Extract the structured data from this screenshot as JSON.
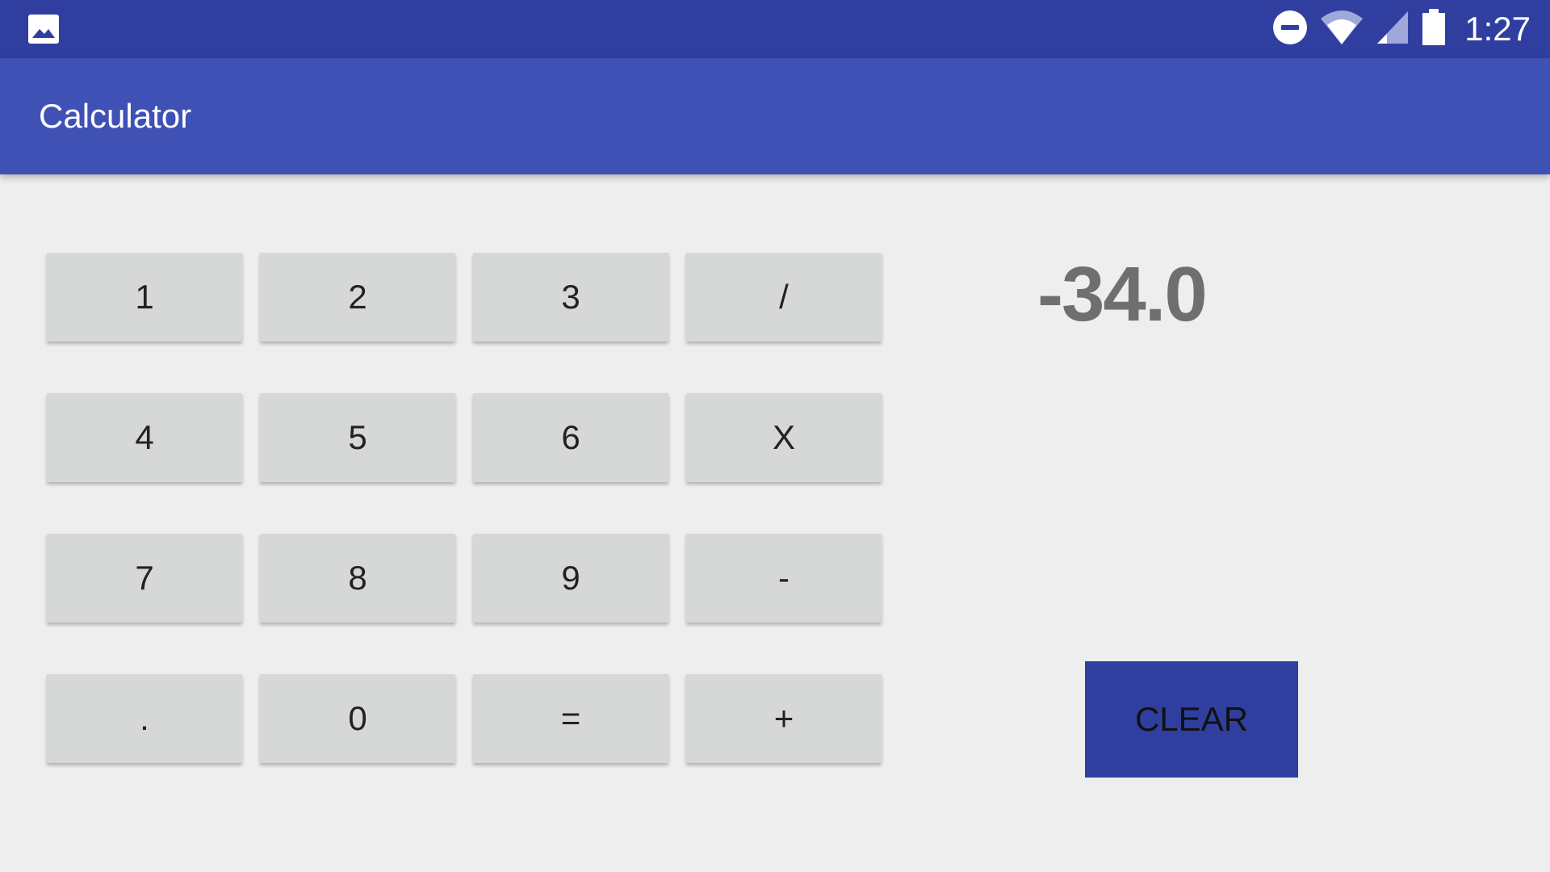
{
  "status_bar": {
    "time": "1:27",
    "icons": [
      "image-icon",
      "do-not-disturb-icon",
      "wifi-icon",
      "signal-icon",
      "battery-icon"
    ]
  },
  "app_bar": {
    "title": "Calculator"
  },
  "display": {
    "value": "-34.0"
  },
  "keypad": {
    "keys": [
      "1",
      "2",
      "3",
      "/",
      "4",
      "5",
      "6",
      "X",
      "7",
      "8",
      "9",
      "-",
      ".",
      "0",
      "=",
      "+"
    ]
  },
  "clear_button": {
    "label": "CLEAR"
  },
  "colors": {
    "status_bar": "#303f9f",
    "app_bar": "#3f51b5",
    "background": "#eeeeee",
    "key": "#d6d7d7",
    "display_text": "#6f6f6f",
    "clear_button": "#303f9f"
  }
}
